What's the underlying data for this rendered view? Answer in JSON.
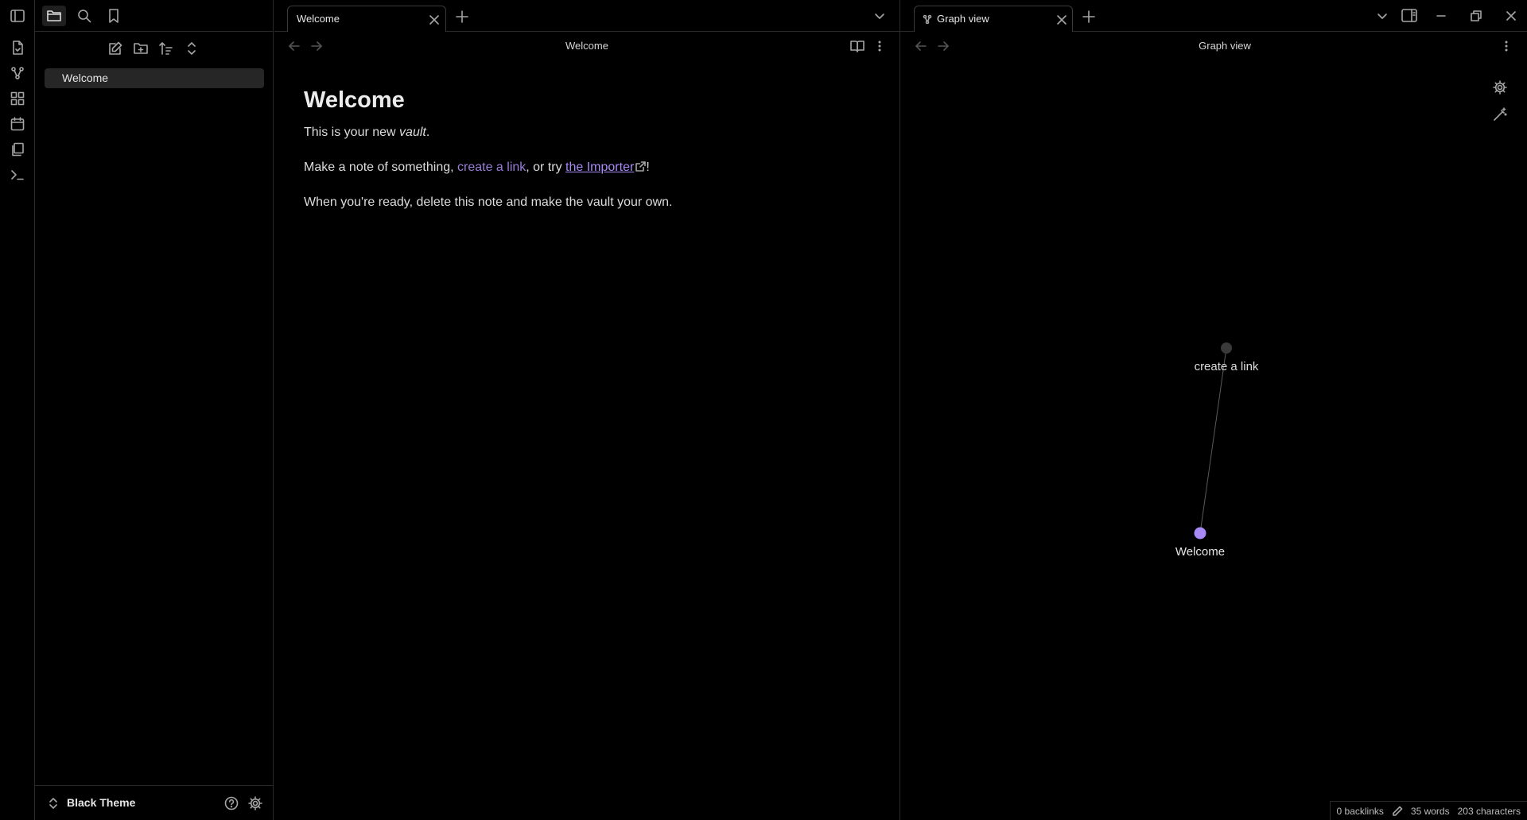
{
  "sidebar": {
    "files": [
      {
        "name": "Welcome"
      }
    ],
    "vault_name": "Black Theme"
  },
  "left_pane": {
    "tab_label": "Welcome",
    "header_title": "Welcome",
    "note": {
      "heading": "Welcome",
      "p1_before": "This is your new ",
      "p1_em": "vault",
      "p1_after": ".",
      "p2_before": "Make a note of something, ",
      "p2_internal_link": "create a link",
      "p2_middle": ", or try ",
      "p2_external_link": "the Importer",
      "p2_after": "!",
      "p3": "When you're ready, delete this note and make the vault your own."
    }
  },
  "right_pane": {
    "tab_label": "Graph view",
    "header_title": "Graph view",
    "graph": {
      "nodes": [
        {
          "label": "create a link",
          "color": "#3a3a3a"
        },
        {
          "label": "Welcome",
          "color": "#a78af5"
        }
      ],
      "edges": [
        [
          "create a link",
          "Welcome"
        ]
      ]
    }
  },
  "status": {
    "backlinks": "0 backlinks",
    "words": "35 words",
    "characters": "203 characters"
  },
  "colors": {
    "accent": "#a78af5",
    "background": "#000000",
    "border": "#2a2a2a"
  }
}
